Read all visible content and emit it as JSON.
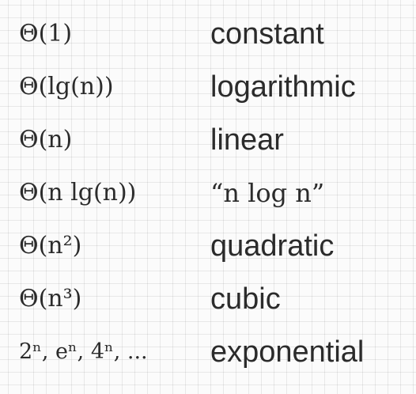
{
  "rows": [
    {
      "notation": "Θ(1)",
      "name": "constant"
    },
    {
      "notation": "Θ(lg(n))",
      "name": "logarithmic"
    },
    {
      "notation": "Θ(n)",
      "name": "linear"
    },
    {
      "notation": "Θ(n lg(n))",
      "name": "“n log n”"
    },
    {
      "notation": "Θ(n²)",
      "name": "quadratic"
    },
    {
      "notation": "Θ(n³)",
      "name": "cubic"
    },
    {
      "notation": "2ⁿ, eⁿ, 4ⁿ, ...",
      "name": "exponential"
    }
  ],
  "colors": {
    "background": "#fbfbfb",
    "grid": "#e6e6e6",
    "text": "#2b2b2b"
  }
}
